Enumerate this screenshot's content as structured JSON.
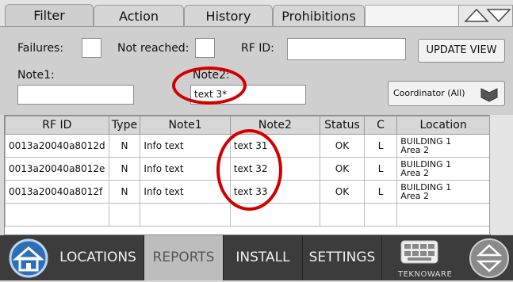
{
  "tabs": [
    "Filter",
    "Action",
    "History",
    "Prohibitions"
  ],
  "filter": {
    "failures_label": "Failures:",
    "not_reached_label": "Not reached:",
    "rfid_label": "RF ID:",
    "rfid_value": "",
    "update_button": "UPDATE VIEW",
    "note1_label": "Note1:",
    "note1_value": "",
    "note2_label": "Note2:",
    "note2_value": "text 3*",
    "coordinator_value": "Coordinator (All)"
  },
  "table": {
    "headers": [
      "RF ID",
      "Type",
      "Note1",
      "Note2",
      "Status",
      "C",
      "Location"
    ],
    "rows": [
      {
        "rfid": "0013a20040a8012d",
        "type": "N",
        "note1": "Info text",
        "note2": "text 31",
        "status": "OK",
        "c": "L",
        "loc1": "BUILDING 1",
        "loc2": "Area 2"
      },
      {
        "rfid": "0013a20040a8012e",
        "type": "N",
        "note1": "Info text",
        "note2": "text 32",
        "status": "OK",
        "c": "L",
        "loc1": "BUILDING 1",
        "loc2": "Area 2"
      },
      {
        "rfid": "0013a20040a8012f",
        "type": "N",
        "note1": "Info text",
        "note2": "text 33",
        "status": "OK",
        "c": "L",
        "loc1": "BUILDING 1",
        "loc2": "Area 2"
      }
    ]
  },
  "nav": {
    "home_icon": "home-icon",
    "items": [
      "LOCATIONS",
      "REPORTS",
      "INSTALL",
      "SETTINGS"
    ],
    "active": "REPORTS",
    "brand": "TEKNOWARE"
  },
  "colors": {
    "annotation": "#d10000",
    "nav_bg": "#3c3c3c",
    "home_blue": "#2a6fb8"
  }
}
